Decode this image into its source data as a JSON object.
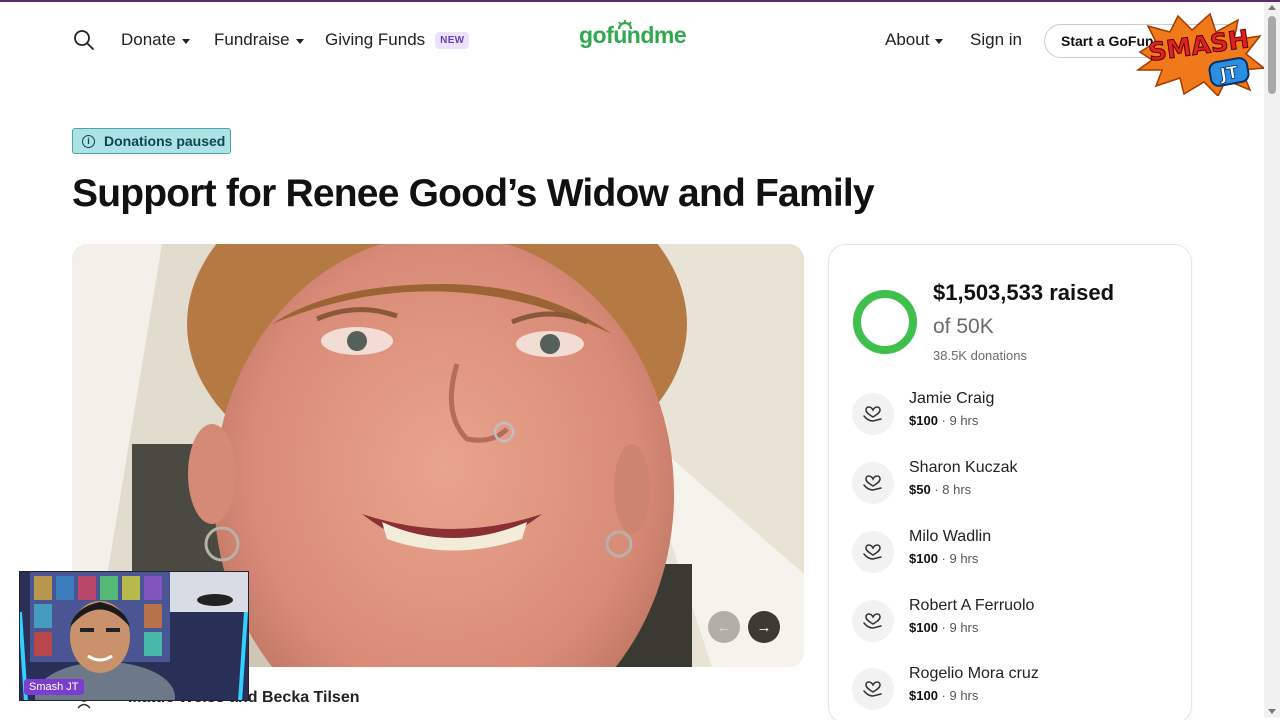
{
  "header": {
    "nav_left": [
      {
        "label": "Donate",
        "has_caret": true
      },
      {
        "label": "Fundraise",
        "has_caret": true
      },
      {
        "label": "Giving Funds",
        "badge": "NEW"
      }
    ],
    "logo_text": "gofundme",
    "nav_right": [
      {
        "label": "About",
        "has_caret": true
      },
      {
        "label": "Sign in"
      }
    ],
    "cta_label": "Start a GoFundMe",
    "brand_color": "#2fa84f"
  },
  "overlay": {
    "logo_line1": "SMASH",
    "logo_line2": "JT",
    "webcam_label": "Smash JT"
  },
  "campaign": {
    "status_badge": "Donations paused",
    "title": "Support for Renee Good’s Widow and Family",
    "organizers": "Mattie Weiss and Becka Tilsen",
    "carousel_prev": "←",
    "carousel_next": "→"
  },
  "progress": {
    "raised": "$1,503,533 raised",
    "goal": "of 50K",
    "donations": "38.5K donations",
    "progress_fraction": 1.0,
    "ring_color": "#3fbf4c"
  },
  "donors": [
    {
      "name": "Jamie Craig",
      "amount": "$100",
      "time": "9 hrs"
    },
    {
      "name": "Sharon Kuczak",
      "amount": "$50",
      "time": "8 hrs"
    },
    {
      "name": "Milo Wadlin",
      "amount": "$100",
      "time": "9 hrs"
    },
    {
      "name": "Robert A Ferruolo",
      "amount": "$100",
      "time": "9 hrs"
    },
    {
      "name": "Rogelio Mora cruz",
      "amount": "$100",
      "time": "9 hrs"
    }
  ]
}
